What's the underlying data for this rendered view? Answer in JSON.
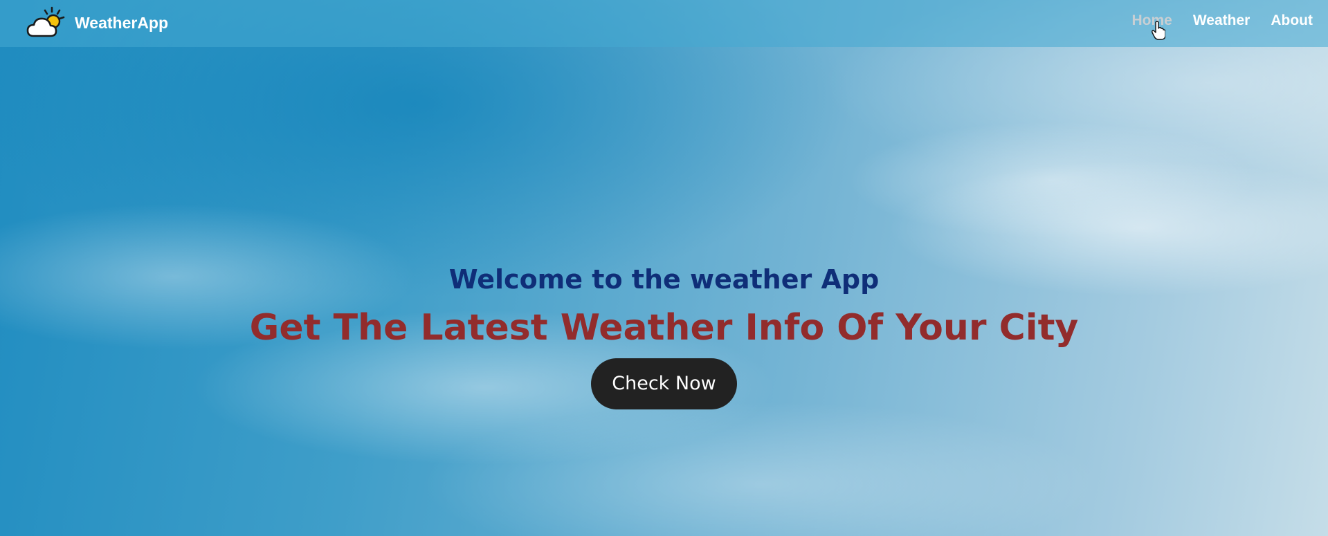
{
  "brand": {
    "name": "WeatherApp",
    "icon": "sun-cloud-icon"
  },
  "nav": {
    "items": [
      {
        "label": "Home",
        "active": true
      },
      {
        "label": "Weather",
        "active": false
      },
      {
        "label": "About",
        "active": false
      }
    ]
  },
  "hero": {
    "welcome": "Welcome to the weather App",
    "headline": "Get The Latest Weather Info Of Your City",
    "cta_label": "Check Now"
  },
  "colors": {
    "welcome_text": "#0f2e78",
    "headline_text": "#922c2c",
    "cta_background": "#222222",
    "nav_active": "#c9cfd3"
  }
}
